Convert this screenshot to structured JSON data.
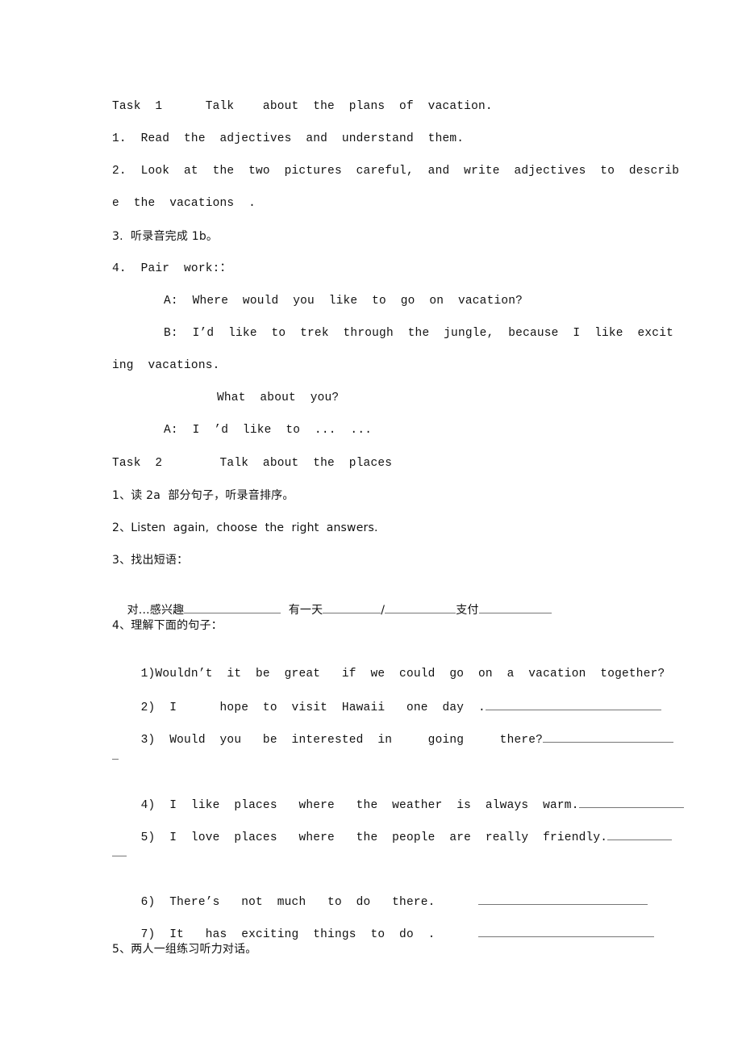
{
  "task1": {
    "heading": "Task  1      Talk    about  the  plans  of  vacation.",
    "items": [
      "1.  Read  the  adjectives  and  understand  them.",
      "2.  Look  at  the  two  pictures  careful,  and  write  adjectives  to  describ",
      "e  the  vacations  .",
      "3.  听录音完成 1b。",
      "4.  Pair  work:："
    ],
    "dialogue": [
      "A:  Where  would  you  like  to  go  on  vacation?",
      "B:  I’d  like  to  trek  through  the  jungle,  because  I  like  excit",
      "ing  vacations.",
      "What  about  you?",
      "A:  I  ’d  like  to  ...  ..."
    ]
  },
  "task2": {
    "heading": "Task  2        Talk  about  the  places",
    "items": [
      "1、读 2a  部分句子，听录音排序。",
      "2、Listen  again,  choose  the  right  answers.",
      "3、找出短语：",
      "4、理解下面的句子："
    ],
    "phrases": [
      {
        "label": "对...感兴趣",
        "value": ""
      },
      {
        "label": "有一天",
        "value": ""
      },
      {
        "label": "/",
        "value": ""
      },
      {
        "label": "支付",
        "value": ""
      }
    ],
    "sentences": [
      {
        "text": "1)Wouldn’t  it  be  great   if  we  could  go  on  a  vacation  together?",
        "answer": ""
      },
      {
        "text": "2)  I      hope  to  visit  Hawaii   one  day  .",
        "answer": ""
      },
      {
        "text": "3)  Would  you   be  interested  in     going     there?",
        "answer": ""
      },
      {
        "text": "4)  I  like  places   where   the  weather  is  always  warm.",
        "answer": ""
      },
      {
        "text": "5)  I  love  places   where   the  people  are  really  friendly.",
        "answer": ""
      },
      {
        "text": "6)  There’s   not  much   to  do   there.",
        "answer": ""
      },
      {
        "text": "7)  It   has  exciting  things  to  do  .",
        "answer": ""
      }
    ],
    "final": "5、两人一组练习听力对话。"
  }
}
